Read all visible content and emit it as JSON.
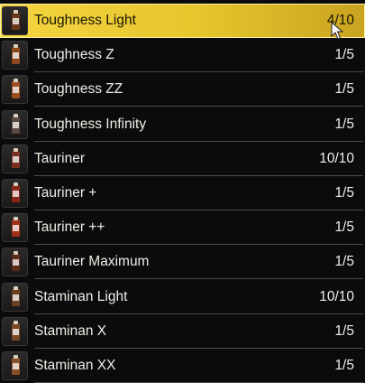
{
  "items": [
    {
      "name": "Toughness Light",
      "qty": "4/10",
      "selected": true,
      "bottle": "#6b3a1c"
    },
    {
      "name": "Toughness Z",
      "qty": "1/5",
      "selected": false,
      "bottle": "#8a4a1e"
    },
    {
      "name": "Toughness ZZ",
      "qty": "1/5",
      "selected": false,
      "bottle": "#9a5020"
    },
    {
      "name": "Toughness Infinity",
      "qty": "1/5",
      "selected": false,
      "bottle": "#5a4a40"
    },
    {
      "name": "Tauriner",
      "qty": "10/10",
      "selected": false,
      "bottle": "#7a3020"
    },
    {
      "name": "Tauriner +",
      "qty": "1/5",
      "selected": false,
      "bottle": "#8a2818"
    },
    {
      "name": "Tauriner ++",
      "qty": "1/5",
      "selected": false,
      "bottle": "#a03018"
    },
    {
      "name": "Tauriner Maximum",
      "qty": "1/5",
      "selected": false,
      "bottle": "#5c2a1a"
    },
    {
      "name": "Staminan Light",
      "qty": "10/10",
      "selected": false,
      "bottle": "#6a4020"
    },
    {
      "name": "Staminan X",
      "qty": "1/5",
      "selected": false,
      "bottle": "#7a4a24"
    },
    {
      "name": "Staminan XX",
      "qty": "1/5",
      "selected": false,
      "bottle": "#8a5028"
    }
  ],
  "icons": {
    "item": "drink-bottle-icon",
    "cursor": "mouse-pointer-icon"
  }
}
